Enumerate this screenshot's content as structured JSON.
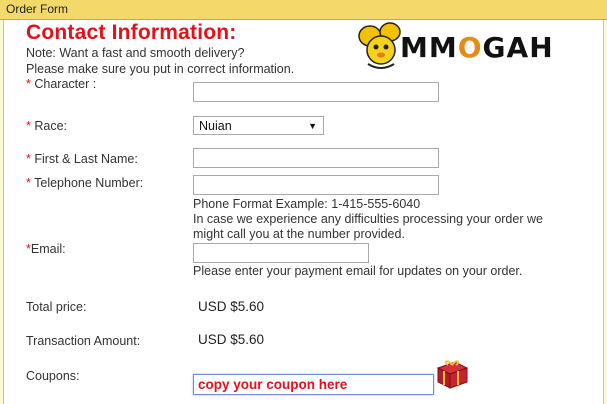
{
  "window": {
    "title": "Order Form"
  },
  "contact": {
    "heading": "Contact Information:",
    "note_line1": "Note: Want a fast and smooth delivery?",
    "note_line2": "Please make sure you put in correct information."
  },
  "logo": {
    "pre": "MM",
    "o": "O",
    "post": "GAH"
  },
  "form": {
    "character": {
      "required_mark": "*",
      "label": " Character :",
      "value": ""
    },
    "race": {
      "required_mark": "*",
      "label": " Race:",
      "selected": "Nuian"
    },
    "name": {
      "required_mark": "*",
      "label": " First & Last Name:",
      "value": ""
    },
    "phone": {
      "required_mark": "*",
      "label": " Telephone Number:",
      "value": "",
      "hint_line1": "Phone Format Example: 1-415-555-6040",
      "hint_line2": "In case we experience any difficulties processing your order we",
      "hint_line3": "might call you at the number provided."
    },
    "email": {
      "required_mark": "*",
      "label": "Email:",
      "value": "",
      "hint": "Please enter your payment email for updates on your order."
    },
    "total_price": {
      "label": "Total price:",
      "value": "USD $5.60"
    },
    "transaction_amount": {
      "label": "Transaction Amount:",
      "value": "USD $5.60"
    },
    "coupons": {
      "label": "Coupons:",
      "placeholder": "copy your coupon here"
    }
  },
  "colors": {
    "accent_red": "#e4111b",
    "titlebar": "#f3d86a",
    "background": "#fbfbd2"
  },
  "icons": {
    "logo_mascot": "mouse-mascot-icon",
    "gift": "gift-box-icon",
    "dropdown": "chevron-down-icon"
  }
}
